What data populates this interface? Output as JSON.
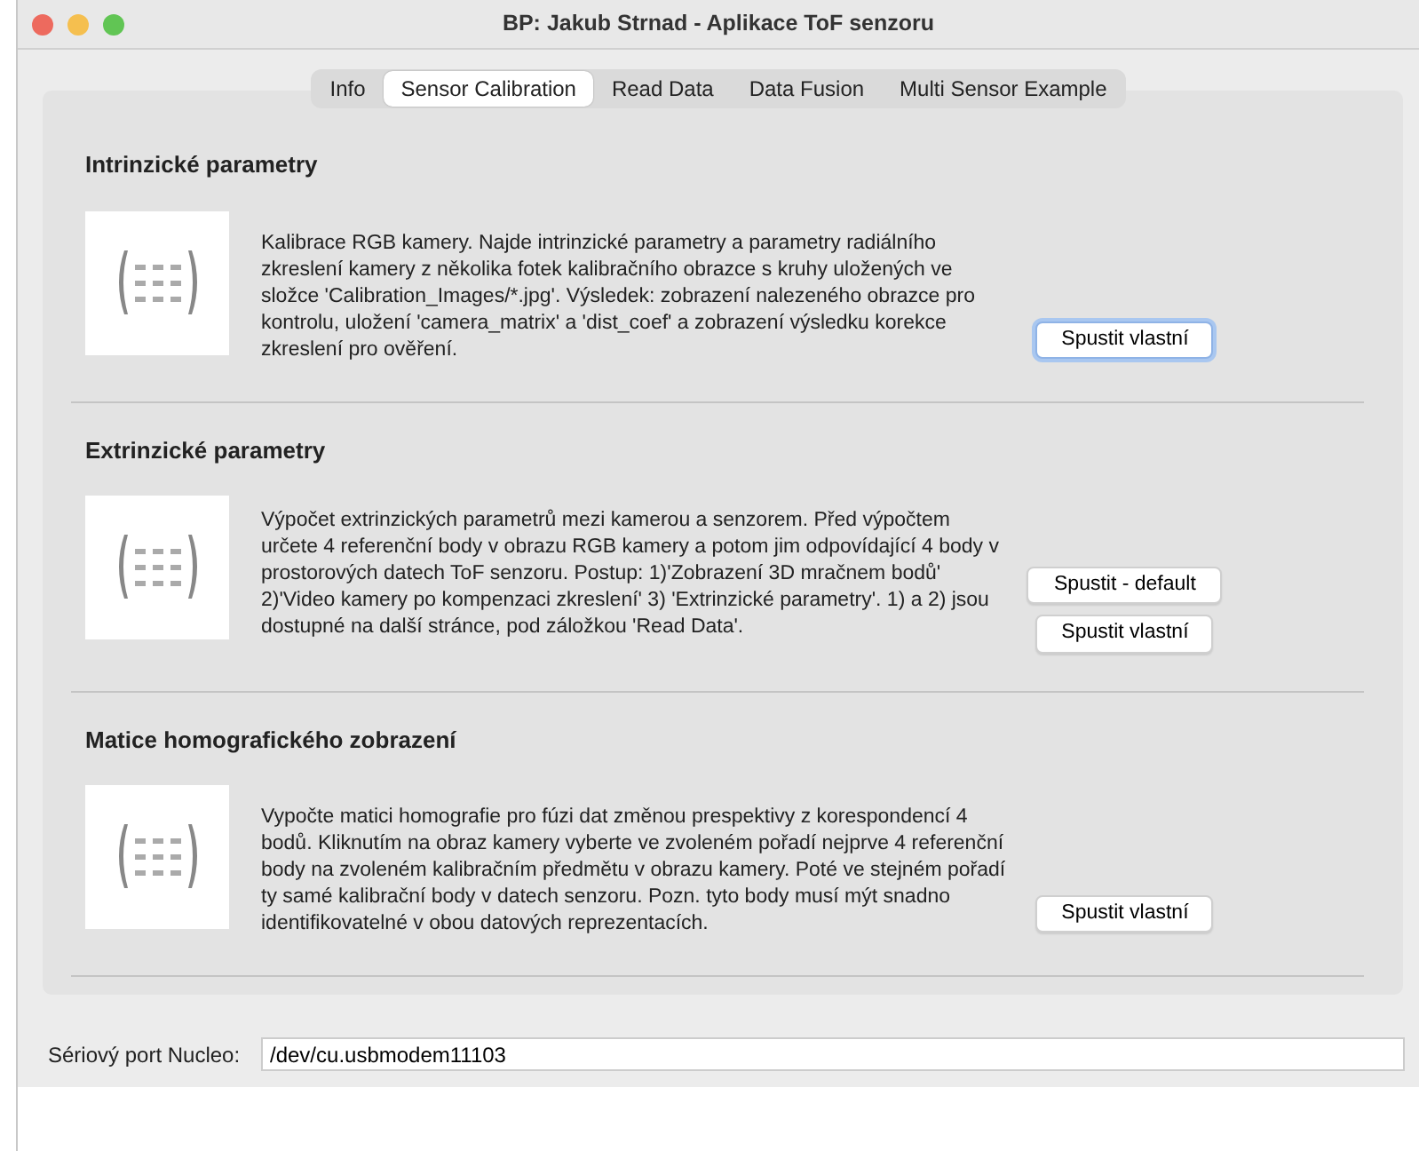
{
  "window": {
    "title": "BP: Jakub Strnad - Aplikace ToF senzoru"
  },
  "tabs": [
    {
      "label": "Info",
      "selected": false
    },
    {
      "label": "Sensor Calibration",
      "selected": true
    },
    {
      "label": "Read Data",
      "selected": false
    },
    {
      "label": "Data Fusion",
      "selected": false
    },
    {
      "label": "Multi Sensor Example",
      "selected": false
    }
  ],
  "sections": [
    {
      "heading": "Intrinzické parametry",
      "image": {
        "kind": "picture"
      },
      "description": "Kalibrace RGB kamery. Najde intrinzické parametry a parametry radiálního zkreslení kamery z několika fotek kalibračního obrazce s kruhy uložených ve složce 'Calibration_Images/*.jpg'. Výsledek: zobrazení nalezeného obrazce pro kontrolu, uložení 'camera_matrix' a 'dist_coef' a zobrazení výsledku korekce zkreslení pro ověření.",
      "buttons": [
        {
          "label": "Spustit vlastní",
          "focused": true
        }
      ]
    },
    {
      "heading": "Extrinzické parametry",
      "image": {
        "kind": "picture"
      },
      "description": "Výpočet extrinzických parametrů mezi kamerou a senzorem. Před výpočtem určete 4 referenční body v obrazu RGB kamery a potom jim odpovídající 4 body v prostorových datech ToF senzoru. Postup: 1)'Zobrazení 3D mračnem bodů' 2)'Video kamery po kompenzaci zkreslení' 3) 'Extrinzické parametry'. 1) a 2) jsou dostupné na další stránce, pod záložkou 'Read Data'.",
      "buttons": [
        {
          "label": "Spustit - default",
          "focused": false
        },
        {
          "label": "Spustit vlastní",
          "focused": false
        }
      ]
    },
    {
      "heading": "Matice homografického zobrazení",
      "image": {
        "kind": "picture"
      },
      "description": "Vypočte matici homografie pro fúzi dat změnou prespektivy z korespondencí 4 bodů. Kliknutím na obraz kamery vyberte ve zvoleném pořadí nejprve 4 referenční body na zvoleném kalibračním předmětu v obrazu kamery. Poté ve stejném pořadí ty samé kalibrační body v datech senzoru. Pozn. tyto body musí mýt snadno identifikovatelné v obou datových reprezentacích.",
      "buttons": [
        {
          "label": "Spustit vlastní",
          "focused": false
        }
      ]
    }
  ],
  "serial_port": {
    "label": "Sériový port Nucleo:",
    "value": "/dev/cu.usbmodem11103"
  }
}
